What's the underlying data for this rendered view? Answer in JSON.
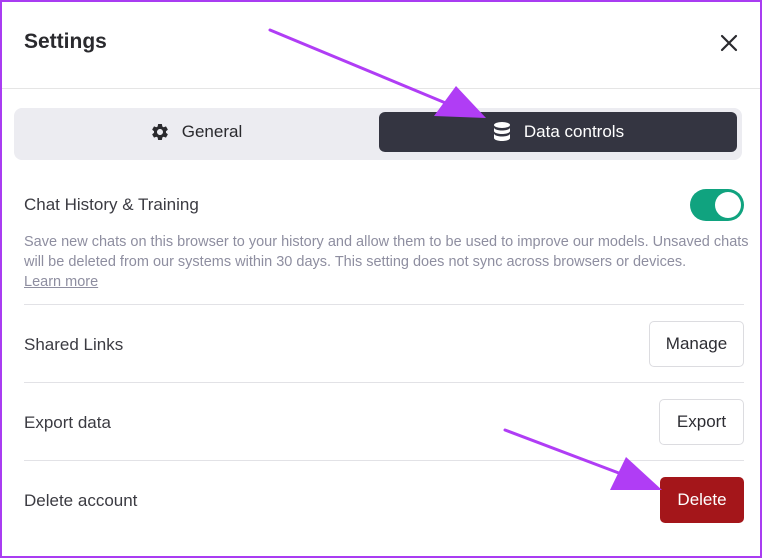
{
  "dialog": {
    "title": "Settings"
  },
  "icons": {
    "close": "close-icon",
    "general": "gear-icon",
    "data": "database-icon"
  },
  "tabs": [
    {
      "label": "General",
      "selected": false
    },
    {
      "label": "Data controls",
      "selected": true
    }
  ],
  "chat_history": {
    "label": "Chat History & Training",
    "toggle_on": true,
    "description": "Save new chats on this browser to your history and allow them to be used to improve our models. Unsaved chats will be deleted from our systems within 30 days. This setting does not sync across browsers or devices.",
    "link_text": "Learn more"
  },
  "shared_links": {
    "label": "Shared Links",
    "button": "Manage"
  },
  "export_data": {
    "label": "Export data",
    "button": "Export"
  },
  "delete_account": {
    "label": "Delete account",
    "button": "Delete"
  },
  "colors": {
    "frame_border": "#a93cf2",
    "active_tab": "#343541",
    "toggle_on": "#10a37f",
    "danger": "#a4161a",
    "annotation_arrow": "#b03df5"
  }
}
